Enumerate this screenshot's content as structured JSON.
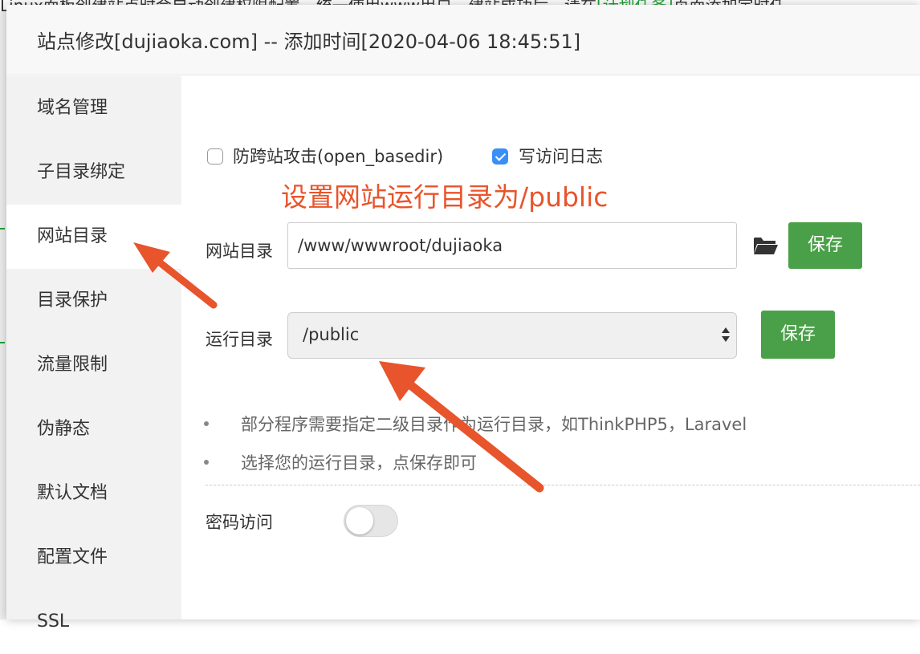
{
  "background": {
    "strip_text": "Linux面板创建站点时会自动创建权限配置，统一使用www用户，建站成功后，请在",
    "strip_link": "[计划任务]",
    "strip_tail": "页面添加定时任"
  },
  "dialog": {
    "title": "站点修改[dujiaoka.com] -- 添加时间[2020-04-06 18:45:51]"
  },
  "sidebar": {
    "items": [
      {
        "label": "域名管理"
      },
      {
        "label": "子目录绑定"
      },
      {
        "label": "网站目录"
      },
      {
        "label": "目录保护"
      },
      {
        "label": "流量限制"
      },
      {
        "label": "伪静态"
      },
      {
        "label": "默认文档"
      },
      {
        "label": "配置文件"
      },
      {
        "label": "SSL"
      }
    ],
    "active_index": 2
  },
  "options": {
    "anti_xss_label": "防跨站攻击(open_basedir)",
    "anti_xss_checked": false,
    "access_log_label": "写访问日志",
    "access_log_checked": true
  },
  "annotation": "设置网站运行目录为/public",
  "site_dir": {
    "label": "网站目录",
    "value": "/www/wwwroot/dujiaoka",
    "icon": "folder-open-icon",
    "save_label": "保存"
  },
  "run_dir": {
    "label": "运行目录",
    "selected": "/public",
    "save_label": "保存"
  },
  "tips": [
    "部分程序需要指定二级目录作为运行目录，如ThinkPHP5，Laravel",
    "选择您的运行目录，点保存即可"
  ],
  "password_access": {
    "label": "密码访问",
    "enabled": false
  },
  "colors": {
    "accent_green": "#4aa048",
    "annotation_red": "#e8542b",
    "checkbox_blue": "#3a8ef6"
  }
}
